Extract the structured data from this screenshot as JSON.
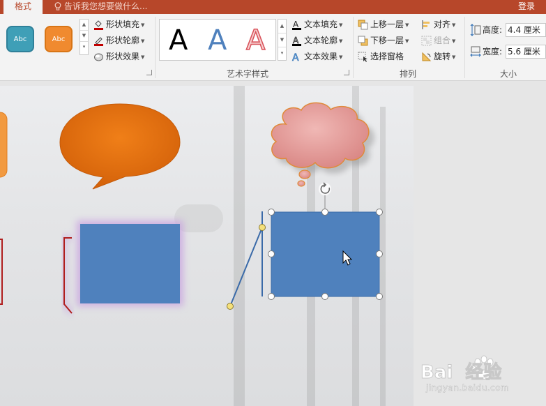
{
  "titlebar": {
    "tab": "格式",
    "tellme": "告诉我您想要做什么...",
    "login": "登录"
  },
  "shape_styles": {
    "swatches": [
      {
        "label": "Abc",
        "color": "#3f9fb7"
      },
      {
        "label": "Abc",
        "color": "#f08a2f"
      }
    ],
    "fill": "形状填充",
    "outline": "形状轮廓",
    "effects": "形状效果"
  },
  "wordart": {
    "group": "艺术字样式",
    "samples": [
      "A",
      "A",
      "A"
    ],
    "fill": "文本填充",
    "outline": "文本轮廓",
    "effects": "文本效果"
  },
  "arrange": {
    "group": "排列",
    "bring_forward": "上移一层",
    "send_backward": "下移一层",
    "selection_pane": "选择窗格",
    "align": "对齐",
    "group_cmd": "组合",
    "rotate": "旋转"
  },
  "size": {
    "group": "大小",
    "height_label": "高度:",
    "height_value": "4.4 厘米",
    "width_label": "宽度:",
    "width_value": "5.6 厘米"
  },
  "colors": {
    "accent": "#b7472a",
    "shape_blue": "#4f81bd",
    "bubble_orange": "#e46c0a",
    "cloud_pink": "#e09a9a"
  },
  "watermark": {
    "brand": "Bai  经验",
    "url": "jingyan.baidu.com"
  }
}
